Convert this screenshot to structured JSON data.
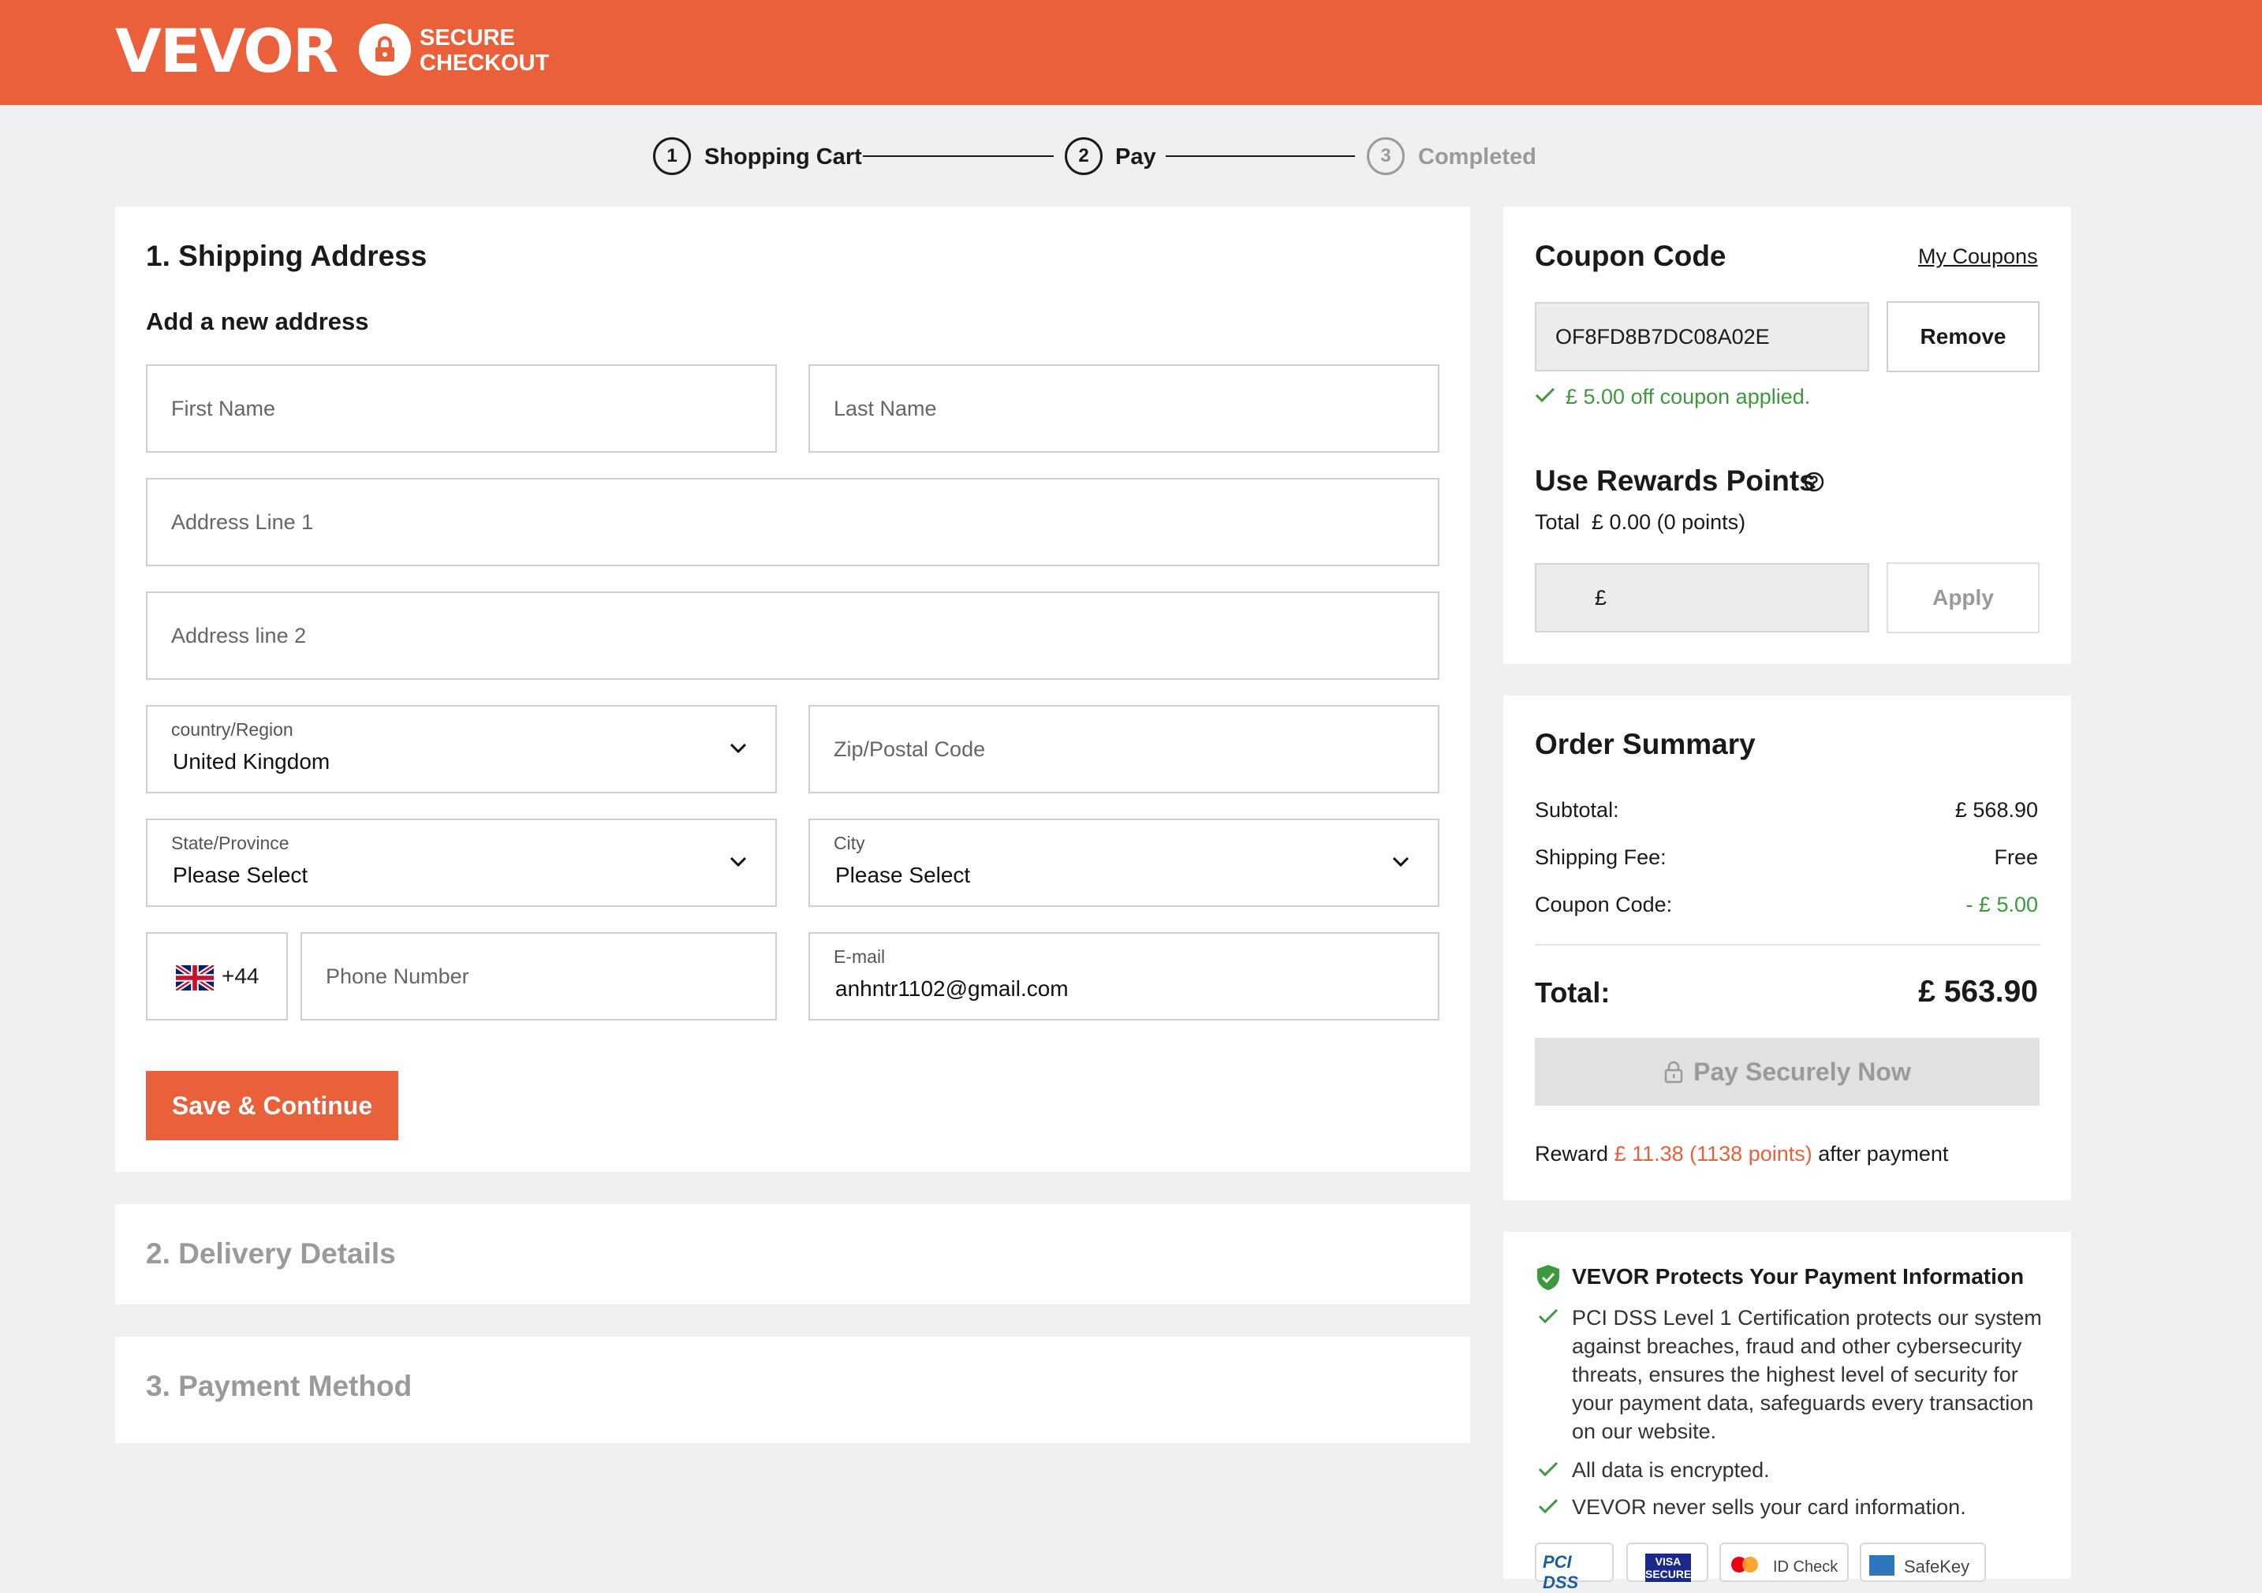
{
  "header": {
    "logo": "VEVOR",
    "secure_line1": "SECURE",
    "secure_line2": "CHECKOUT"
  },
  "steps": [
    {
      "number": "1",
      "label": "Shopping Cart"
    },
    {
      "number": "2",
      "label": "Pay"
    },
    {
      "number": "3",
      "label": "Completed"
    }
  ],
  "shipping": {
    "title": "1. Shipping Address",
    "subtitle": "Add a new address",
    "first_name_placeholder": "First Name",
    "last_name_placeholder": "Last Name",
    "address1_placeholder": "Address Line 1",
    "address2_placeholder": "Address line 2",
    "country_label": "country/Region",
    "country_value": "United Kingdom",
    "zip_placeholder": "Zip/Postal Code",
    "state_label": "State/Province",
    "state_value": "Please Select",
    "city_label": "City",
    "city_value": "Please Select",
    "phone_code": "+44",
    "phone_placeholder": "Phone Number",
    "email_label": "E-mail",
    "email_value": "anhntr1102@gmail.com",
    "save_button": "Save & Continue"
  },
  "delivery": {
    "title": "2. Delivery Details"
  },
  "payment": {
    "title": "3. Payment Method"
  },
  "coupon": {
    "title": "Coupon Code",
    "my_coupons": "My Coupons",
    "code": "OF8FD8B7DC08A02E",
    "remove_button": "Remove",
    "applied_message": "£ 5.00 off coupon applied."
  },
  "rewards": {
    "title": "Use Rewards Points",
    "total_text": "Total  £ 0.00 (0 points)",
    "currency_symbol": "£",
    "apply_button": "Apply"
  },
  "summary": {
    "title": "Order Summary",
    "subtotal_label": "Subtotal:",
    "subtotal_value": "£ 568.90",
    "shipping_label": "Shipping Fee:",
    "shipping_value": "Free",
    "coupon_label": "Coupon Code:",
    "coupon_value": "- £ 5.00",
    "total_label": "Total:",
    "total_value": "£ 563.90",
    "pay_button": "Pay Securely Now",
    "reward_prefix": "Reward",
    "reward_amount": "£ 11.38 (1138 points)",
    "reward_suffix": "after payment"
  },
  "protection": {
    "title": "VEVOR Protects Your Payment Information",
    "bullet1": "PCI DSS Level 1 Certification protects our system against breaches, fraud and other cybersecurity threats, ensures the highest level of security for your payment data, safeguards every transaction on our website.",
    "bullet2": "All data is encrypted.",
    "bullet3": "VEVOR never sells your card information.",
    "badges": [
      "PCI DSS",
      "VISA SECURE",
      "ID Check",
      "SafeKey"
    ]
  },
  "colors": {
    "brand": "#e9603a",
    "success": "#3c9a3c",
    "background": "#eef0f2"
  }
}
